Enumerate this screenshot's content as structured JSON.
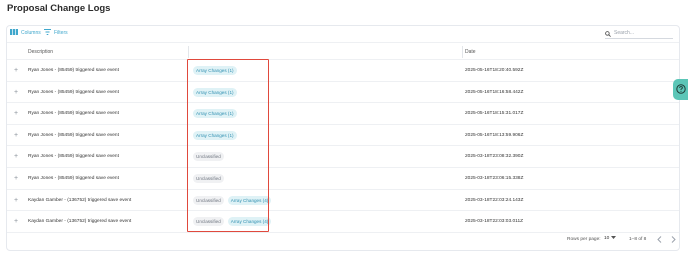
{
  "page": {
    "title": "Proposal Change Logs"
  },
  "toolbar": {
    "columns_label": "Columns",
    "filters_label": "Filters",
    "search_placeholder": "Search..."
  },
  "table": {
    "headers": {
      "description": "Description",
      "date": "Date"
    },
    "rows": [
      {
        "description": "Ryan Jones - (85459) triggered save event",
        "tags": [
          "Array Changes (1)"
        ],
        "date": "2025-05-16T18:20:40.592Z"
      },
      {
        "description": "Ryan Jones - (85459) triggered save event",
        "tags": [
          "Array Changes (1)"
        ],
        "date": "2025-05-16T18:16:58.442Z"
      },
      {
        "description": "Ryan Jones - (85459) triggered save event",
        "tags": [
          "Array Changes (1)"
        ],
        "date": "2025-05-16T18:15:31.017Z"
      },
      {
        "description": "Ryan Jones - (85459) triggered save event",
        "tags": [
          "Array Changes (1)"
        ],
        "date": "2025-05-16T18:13:59.906Z"
      },
      {
        "description": "Ryan Jones - (85459) triggered save event",
        "tags": [
          "Unclassified"
        ],
        "date": "2025-03-18T23:08:32.390Z"
      },
      {
        "description": "Ryan Jones - (85459) triggered save event",
        "tags": [
          "Unclassified"
        ],
        "date": "2025-03-18T23:06:15.338Z"
      },
      {
        "description": "Kaydan Gamber - (136752) triggered save event",
        "tags": [
          "Unclassified",
          "Array Changes (4)"
        ],
        "date": "2025-03-18T22:03:24.143Z"
      },
      {
        "description": "Kaydan Gamber - (136752) triggered save event",
        "tags": [
          "Unclassified",
          "Array Changes (4)"
        ],
        "date": "2025-03-18T22:03:03.011Z"
      }
    ]
  },
  "footer": {
    "rows_per_page_label": "Rows per page:",
    "rows_per_page_value": "10",
    "range_text": "1–8 of 8"
  },
  "icons": {
    "columns": "columns-icon",
    "filters": "filter-icon",
    "search": "search-icon",
    "expand": "plus-icon",
    "prev": "chevron-left-icon",
    "next": "chevron-right-icon",
    "help": "help-icon"
  },
  "colors": {
    "accent": "#3fa7cc",
    "highlight": "#e0493d",
    "help_fab": "#5bc6b7"
  }
}
